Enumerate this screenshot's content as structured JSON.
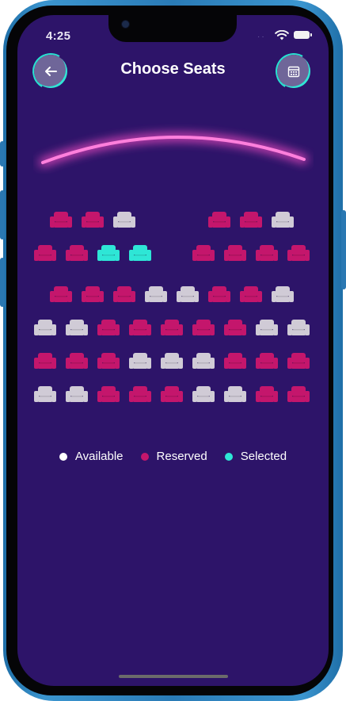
{
  "status_bar": {
    "time": "4:25"
  },
  "header": {
    "title": "Choose Seats",
    "back_icon": "arrow-left-icon",
    "calendar_icon": "calendar-icon"
  },
  "colors": {
    "background": "#2d1469",
    "available": "#d0cbd6",
    "reserved": "#c4166c",
    "selected": "#2ee6d6",
    "screen_glow": "#ff4fc8"
  },
  "seat_rows": [
    [
      "reserved",
      "reserved",
      "available",
      null,
      null,
      "reserved",
      "reserved",
      "available"
    ],
    [
      "reserved",
      "reserved",
      "selected",
      "selected",
      null,
      "reserved",
      "reserved",
      "reserved",
      "reserved"
    ],
    [
      "reserved",
      "reserved",
      "reserved",
      "available",
      "available",
      "reserved",
      "reserved",
      "available"
    ],
    [
      "available",
      "available",
      "reserved",
      "reserved",
      "reserved",
      "reserved",
      "reserved",
      "available",
      "available"
    ],
    [
      "reserved",
      "reserved",
      "reserved",
      "available",
      "available",
      "available",
      "reserved",
      "reserved",
      "reserved"
    ],
    [
      "available",
      "available",
      "reserved",
      "reserved",
      "reserved",
      "available",
      "available",
      "reserved",
      "reserved"
    ]
  ],
  "legend": [
    {
      "label": "Available",
      "color": "#ffffff"
    },
    {
      "label": "Reserved",
      "color": "#c4166c"
    },
    {
      "label": "Selected",
      "color": "#2ee6d6"
    }
  ]
}
